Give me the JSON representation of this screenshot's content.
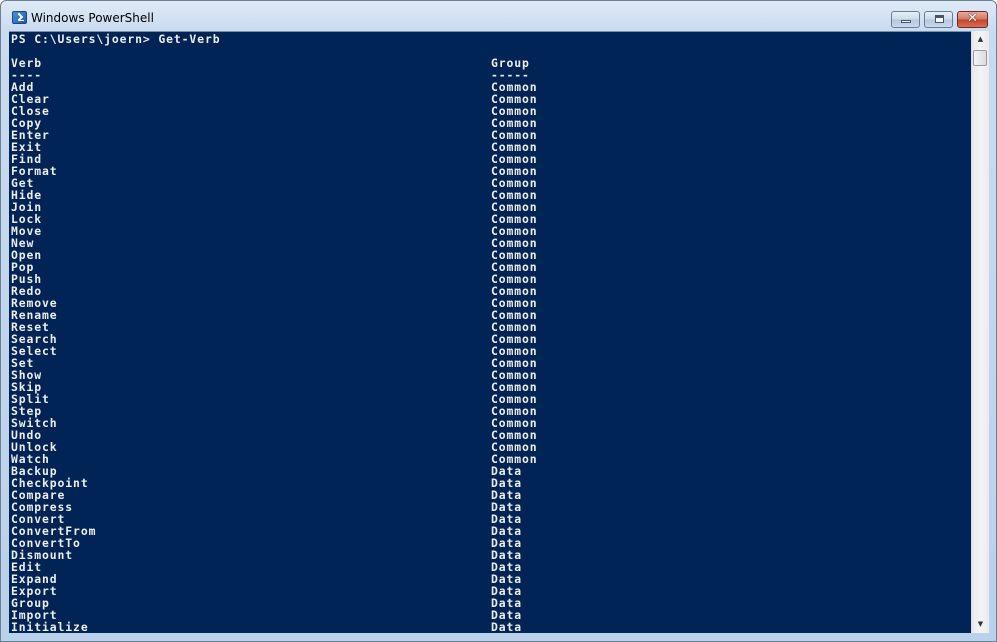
{
  "window": {
    "title": "Windows PowerShell",
    "icon": "powershell-icon",
    "controls": {
      "minimize": "minimize-icon",
      "maximize": "maximize-icon",
      "close_glyph": "✕"
    }
  },
  "colors": {
    "console_background": "#012456",
    "console_foreground": "#eeedf0"
  },
  "console": {
    "prompt": "PS C:\\Users\\joern> ",
    "command": "Get-Verb",
    "headers": {
      "verb": "Verb",
      "group": "Group"
    },
    "underlines": {
      "verb": "----",
      "group": "-----"
    },
    "rows": [
      {
        "verb": "Add",
        "group": "Common"
      },
      {
        "verb": "Clear",
        "group": "Common"
      },
      {
        "verb": "Close",
        "group": "Common"
      },
      {
        "verb": "Copy",
        "group": "Common"
      },
      {
        "verb": "Enter",
        "group": "Common"
      },
      {
        "verb": "Exit",
        "group": "Common"
      },
      {
        "verb": "Find",
        "group": "Common"
      },
      {
        "verb": "Format",
        "group": "Common"
      },
      {
        "verb": "Get",
        "group": "Common"
      },
      {
        "verb": "Hide",
        "group": "Common"
      },
      {
        "verb": "Join",
        "group": "Common"
      },
      {
        "verb": "Lock",
        "group": "Common"
      },
      {
        "verb": "Move",
        "group": "Common"
      },
      {
        "verb": "New",
        "group": "Common"
      },
      {
        "verb": "Open",
        "group": "Common"
      },
      {
        "verb": "Pop",
        "group": "Common"
      },
      {
        "verb": "Push",
        "group": "Common"
      },
      {
        "verb": "Redo",
        "group": "Common"
      },
      {
        "verb": "Remove",
        "group": "Common"
      },
      {
        "verb": "Rename",
        "group": "Common"
      },
      {
        "verb": "Reset",
        "group": "Common"
      },
      {
        "verb": "Search",
        "group": "Common"
      },
      {
        "verb": "Select",
        "group": "Common"
      },
      {
        "verb": "Set",
        "group": "Common"
      },
      {
        "verb": "Show",
        "group": "Common"
      },
      {
        "verb": "Skip",
        "group": "Common"
      },
      {
        "verb": "Split",
        "group": "Common"
      },
      {
        "verb": "Step",
        "group": "Common"
      },
      {
        "verb": "Switch",
        "group": "Common"
      },
      {
        "verb": "Undo",
        "group": "Common"
      },
      {
        "verb": "Unlock",
        "group": "Common"
      },
      {
        "verb": "Watch",
        "group": "Common"
      },
      {
        "verb": "Backup",
        "group": "Data"
      },
      {
        "verb": "Checkpoint",
        "group": "Data"
      },
      {
        "verb": "Compare",
        "group": "Data"
      },
      {
        "verb": "Compress",
        "group": "Data"
      },
      {
        "verb": "Convert",
        "group": "Data"
      },
      {
        "verb": "ConvertFrom",
        "group": "Data"
      },
      {
        "verb": "ConvertTo",
        "group": "Data"
      },
      {
        "verb": "Dismount",
        "group": "Data"
      },
      {
        "verb": "Edit",
        "group": "Data"
      },
      {
        "verb": "Expand",
        "group": "Data"
      },
      {
        "verb": "Export",
        "group": "Data"
      },
      {
        "verb": "Group",
        "group": "Data"
      },
      {
        "verb": "Import",
        "group": "Data"
      },
      {
        "verb": "Initialize",
        "group": "Data"
      }
    ]
  },
  "scrollbar": {
    "up_arrow": "▲",
    "down_arrow": "▼",
    "position_fraction": 0.0
  }
}
